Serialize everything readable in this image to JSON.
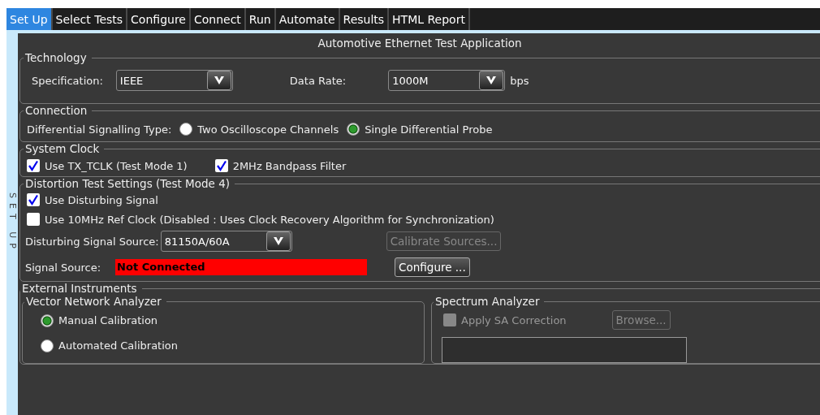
{
  "tabs": [
    {
      "label": "Set Up",
      "selected": true
    },
    {
      "label": "Select Tests",
      "selected": false
    },
    {
      "label": "Configure",
      "selected": false
    },
    {
      "label": "Connect",
      "selected": false
    },
    {
      "label": "Run",
      "selected": false
    },
    {
      "label": "Automate",
      "selected": false
    },
    {
      "label": "Results",
      "selected": false
    },
    {
      "label": "HTML Report",
      "selected": false
    }
  ],
  "side_label": "SET UP",
  "title": "Automotive Ethernet Test Application",
  "technology": {
    "legend": "Technology",
    "specification": {
      "label": "Specification:",
      "value": "IEEE"
    },
    "data_rate": {
      "label": "Data Rate:",
      "value": "1000M",
      "unit": "bps"
    }
  },
  "connection": {
    "legend": "Connection",
    "label": "Differential Signalling Type:",
    "options": [
      {
        "label": "Two Oscilloscope Channels",
        "selected": false
      },
      {
        "label": "Single Differential Probe",
        "selected": true
      }
    ]
  },
  "system_clock": {
    "legend": "System Clock",
    "checkboxes": [
      {
        "label": "Use TX_TCLK (Test Mode 1)",
        "checked": true
      },
      {
        "label": "2MHz Bandpass Filter",
        "checked": true
      }
    ]
  },
  "distortion": {
    "legend": "Distortion Test Settings (Test Mode 4)",
    "checkboxes": [
      {
        "label": "Use Disturbing Signal",
        "checked": true
      },
      {
        "label": "Use 10MHz Ref Clock (Disabled : Uses Clock Recovery Algorithm for Synchronization)",
        "checked": false
      }
    ],
    "source": {
      "label": "Disturbing Signal Source:",
      "value": "81150A/60A"
    },
    "calibrate_button": {
      "label": "Calibrate Sources...",
      "disabled": true
    },
    "signal_source": {
      "label": "Signal Source:",
      "status": "Not Connected",
      "color": "#ff0000"
    },
    "configure_button": {
      "label": "Configure ...",
      "disabled": false
    }
  },
  "external": {
    "legend": "External Instruments",
    "vna": {
      "legend": "Vector Network Analyzer",
      "options": [
        {
          "label": "Manual Calibration",
          "selected": true
        },
        {
          "label": "Automated Calibration",
          "selected": false
        }
      ]
    },
    "spectrum": {
      "legend": "Spectrum Analyzer",
      "checkbox": {
        "label": "Apply SA Correction",
        "checked": false,
        "disabled": true
      },
      "browse_button": {
        "label": "Browse...",
        "disabled": true
      }
    }
  }
}
